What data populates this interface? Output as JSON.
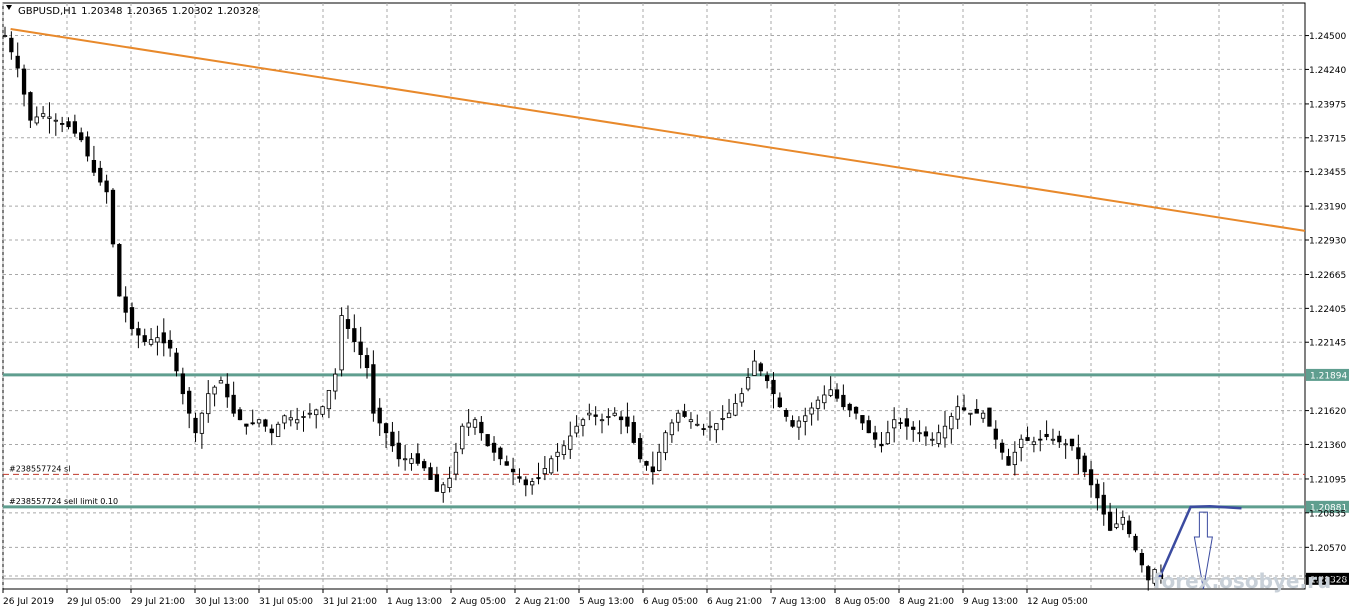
{
  "chart_data": {
    "type": "candlestick",
    "symbol_header": {
      "symbol": "GBPUSD,H1",
      "open": "1.20348",
      "high": "1.20365",
      "low": "1.20302",
      "close": "1.20328"
    },
    "ylim": [
      1.2025,
      1.2475
    ],
    "grid": true,
    "y_ticks": [
      "1.24500",
      "1.24240",
      "1.23975",
      "1.23715",
      "1.23455",
      "1.23190",
      "1.22930",
      "1.22665",
      "1.22405",
      "1.22145",
      "1.21620",
      "1.21360",
      "1.21095",
      "1.20835",
      "1.20570",
      "1.20350"
    ],
    "x_ticks": [
      "26 Jul 2019",
      "29 Jul 05:00",
      "29 Jul 21:00",
      "30 Jul 13:00",
      "31 Jul 05:00",
      "31 Jul 21:00",
      "1 Aug 13:00",
      "2 Aug 05:00",
      "2 Aug 21:00",
      "5 Aug 13:00",
      "6 Aug 05:00",
      "6 Aug 21:00",
      "7 Aug 13:00",
      "8 Aug 05:00",
      "8 Aug 21:00",
      "9 Aug 13:00",
      "12 Aug 05:00"
    ],
    "horizontal_levels": [
      {
        "value": 1.21894,
        "label": "1.21894",
        "color": "#5f9e8f",
        "style": "solid"
      },
      {
        "value": 1.20881,
        "label": "1.20881",
        "color": "#5f9e8f",
        "style": "solid"
      },
      {
        "value": 1.20328,
        "label": "1.20328",
        "color": "#000000",
        "style": "solid",
        "current_price": true
      }
    ],
    "orders": [
      {
        "value": 1.2113,
        "label": "#238557724 sl",
        "color": "#c0392b",
        "style": "dashed"
      },
      {
        "value": 1.20881,
        "label": "#238557724 sell limit 0.10",
        "color": "#5f9e8f",
        "style": "solid"
      }
    ],
    "trendline": {
      "color": "#e8892b",
      "from": {
        "x": 1.2,
        "y": 1.2455
      },
      "to": {
        "x": 205,
        "y": 1.23
      }
    },
    "forecast_path": {
      "color": "#3b4ba0",
      "points": [
        {
          "x": 182,
          "y": 1.20328
        },
        {
          "x": 187,
          "y": 1.20881
        },
        {
          "x": 190,
          "y": 1.20885
        },
        {
          "x": 195,
          "y": 1.2087
        }
      ]
    },
    "forecast_arrow": {
      "color": "#3b4ba0",
      "direction": "down",
      "x": 189,
      "from": 1.2084,
      "to": 1.2025
    },
    "price_path": [
      [
        0,
        1.245
      ],
      [
        2,
        1.2425
      ],
      [
        4,
        1.2385
      ],
      [
        6,
        1.239
      ],
      [
        8,
        1.2385
      ],
      [
        10,
        1.238
      ],
      [
        12,
        1.237
      ],
      [
        14,
        1.2345
      ],
      [
        16,
        1.233
      ],
      [
        18,
        1.225
      ],
      [
        20,
        1.2225
      ],
      [
        22,
        1.2215
      ],
      [
        24,
        1.2218
      ],
      [
        26,
        1.221
      ],
      [
        28,
        1.2175
      ],
      [
        30,
        1.2145
      ],
      [
        32,
        1.2175
      ],
      [
        34,
        1.2185
      ],
      [
        36,
        1.216
      ],
      [
        38,
        1.215
      ],
      [
        40,
        1.2155
      ],
      [
        42,
        1.2145
      ],
      [
        44,
        1.2158
      ],
      [
        46,
        1.2155
      ],
      [
        48,
        1.216
      ],
      [
        50,
        1.2165
      ],
      [
        52,
        1.219
      ],
      [
        53,
        1.2235
      ],
      [
        55,
        1.2215
      ],
      [
        57,
        1.2195
      ],
      [
        58,
        1.216
      ],
      [
        60,
        1.2145
      ],
      [
        62,
        1.2125
      ],
      [
        64,
        1.2125
      ],
      [
        66,
        1.2118
      ],
      [
        68,
        1.21
      ],
      [
        70,
        1.211
      ],
      [
        72,
        1.215
      ],
      [
        74,
        1.2155
      ],
      [
        76,
        1.2135
      ],
      [
        78,
        1.2125
      ],
      [
        80,
        1.2115
      ],
      [
        82,
        1.2105
      ],
      [
        84,
        1.211
      ],
      [
        86,
        1.2125
      ],
      [
        88,
        1.2135
      ],
      [
        90,
        1.215
      ],
      [
        92,
        1.216
      ],
      [
        94,
        1.2155
      ],
      [
        96,
        1.216
      ],
      [
        98,
        1.215
      ],
      [
        100,
        1.2125
      ],
      [
        102,
        1.2115
      ],
      [
        104,
        1.2145
      ],
      [
        106,
        1.216
      ],
      [
        108,
        1.2155
      ],
      [
        110,
        1.2148
      ],
      [
        112,
        1.2152
      ],
      [
        114,
        1.216
      ],
      [
        116,
        1.2175
      ],
      [
        118,
        1.22
      ],
      [
        120,
        1.2185
      ],
      [
        122,
        1.2165
      ],
      [
        124,
        1.215
      ],
      [
        126,
        1.2158
      ],
      [
        128,
        1.217
      ],
      [
        130,
        1.2178
      ],
      [
        132,
        1.2165
      ],
      [
        134,
        1.216
      ],
      [
        136,
        1.2145
      ],
      [
        138,
        1.2135
      ],
      [
        140,
        1.2155
      ],
      [
        142,
        1.215
      ],
      [
        144,
        1.2145
      ],
      [
        146,
        1.214
      ],
      [
        148,
        1.215
      ],
      [
        150,
        1.2165
      ],
      [
        152,
        1.216
      ],
      [
        154,
        1.216
      ],
      [
        156,
        1.214
      ],
      [
        158,
        1.212
      ],
      [
        160,
        1.214
      ],
      [
        162,
        1.2138
      ],
      [
        164,
        1.2142
      ],
      [
        166,
        1.2138
      ],
      [
        168,
        1.2135
      ],
      [
        170,
        1.2115
      ],
      [
        172,
        1.2095
      ],
      [
        174,
        1.207
      ],
      [
        176,
        1.208
      ],
      [
        178,
        1.2055
      ],
      [
        180,
        1.2032
      ],
      [
        181,
        1.204
      ],
      [
        182,
        1.2033
      ]
    ]
  },
  "watermark": "forex.osobye.ru"
}
